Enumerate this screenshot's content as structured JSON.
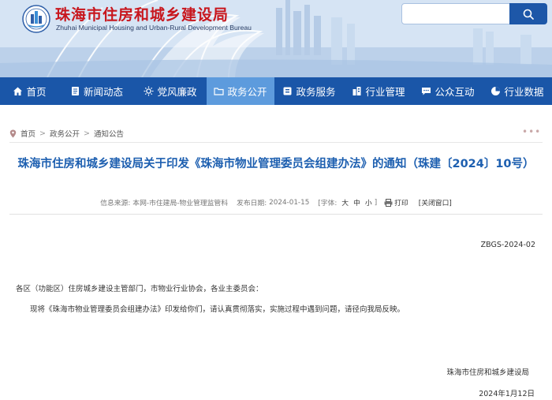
{
  "header": {
    "title": "珠海市住房和城乡建设局",
    "subtitle": "Zhuhai Municipal Housing and Urban-Rural Development Bureau",
    "search": {
      "placeholder": ""
    }
  },
  "nav": {
    "items": [
      {
        "label": "首页",
        "icon": "home-icon"
      },
      {
        "label": "新闻动态",
        "icon": "document-icon"
      },
      {
        "label": "党风廉政",
        "icon": "sun-icon"
      },
      {
        "label": "政务公开",
        "icon": "folder-icon",
        "active": true
      },
      {
        "label": "政务服务",
        "icon": "service-icon"
      },
      {
        "label": "行业管理",
        "icon": "building-icon"
      },
      {
        "label": "公众互动",
        "icon": "chat-icon"
      },
      {
        "label": "行业数据",
        "icon": "pie-chart-icon"
      }
    ]
  },
  "breadcrumb": {
    "home": "首页",
    "sep": ">",
    "level1": "政务公开",
    "level2": "通知公告"
  },
  "article": {
    "title": "珠海市住房和城乡建设局关于印发《珠海市物业管理委员会组建办法》的通知（珠建〔2024〕10号）",
    "meta": {
      "source_label": "信息来源:",
      "source": "本网-市住建局-物业管理监管科",
      "date_label": "发布日期:",
      "date": "2024-01-15",
      "font_label": "[字体:",
      "font_large": "大",
      "font_medium": "中",
      "font_small": "小",
      "font_close": "]",
      "print": "打印",
      "close": "[关闭窗口]"
    },
    "doc_no": "ZBGS-2024-02",
    "salutation": "各区（功能区）住房城乡建设主管部门，市物业行业协会，各业主委员会：",
    "body": "现将《珠海市物业管理委员会组建办法》印发给你们，请认真贯彻落实，实施过程中遇到问题，请径向我局反映。",
    "signature": "珠海市住房和城乡建设局",
    "sign_date": "2024年1月12日"
  }
}
